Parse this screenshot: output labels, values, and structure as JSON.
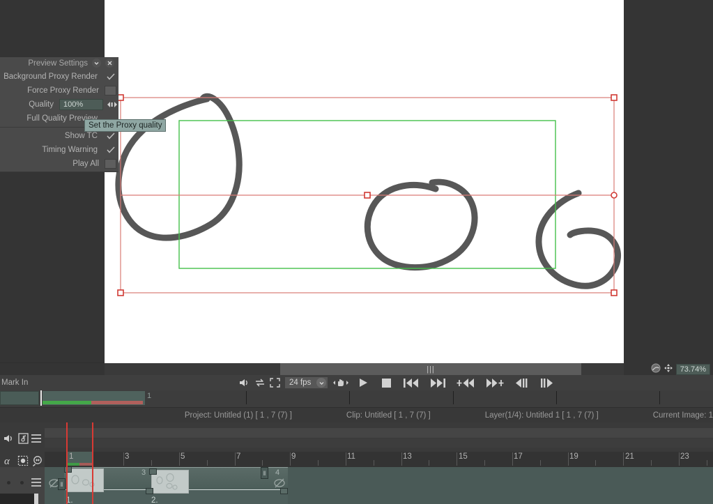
{
  "app": {
    "canvas_bg": "#ffffff",
    "ui_bg": "#3a3a3a",
    "accent_teal": "#4d5c57",
    "guide_green": "#44c04a",
    "guide_red": "#d97b76",
    "playhead_red": "#d93a34"
  },
  "preview_settings": {
    "title": "Preview Settings",
    "collapse_icon": "chevron-down-icon",
    "close_icon": "close-icon",
    "rows": [
      {
        "label": "Background Proxy Render",
        "control": "check",
        "checked": true
      },
      {
        "label": "Force Proxy Render",
        "control": "toggle",
        "checked": false
      },
      {
        "label": "Quality",
        "control": "field",
        "value": "100%"
      },
      {
        "label": "Full Quality Preview",
        "control": "none"
      },
      {
        "label": "Show TC",
        "control": "check",
        "checked": true
      },
      {
        "label": "Timing Warning",
        "control": "check",
        "checked": true
      },
      {
        "label": "Play All",
        "control": "toggle",
        "checked": false
      }
    ]
  },
  "tooltip": {
    "text": "Set the Proxy quality"
  },
  "viewer": {
    "zoom_level": "73.74%",
    "fit_icon": "fit-view-icon",
    "pan_icon": "pan-move-icon",
    "scroll_grip": "|||"
  },
  "transport": {
    "mark_in_label": "Mark In",
    "sound_icon": "speaker-icon",
    "loop_icon": "loop-icon",
    "fullscreen_icon": "fullscreen-icon",
    "fps_value": "24 fps",
    "fps_dropdown_icon": "chevron-down-icon",
    "hand_icon": "hand-scrub-icon",
    "play_icon": "play-icon",
    "stop_icon": "stop-icon",
    "first_frame_icon": "skip-to-start-icon",
    "last_frame_icon": "skip-to-end-icon",
    "prev_mark_icon": "prev-mark-icon",
    "next_mark_icon": "next-mark-icon",
    "step_back_icon": "step-back-icon",
    "step_fwd_icon": "step-forward-icon"
  },
  "scrub": {
    "frame_label": "1"
  },
  "infobar": {
    "items": [
      "Project: Untitled (1) [ 1 , 7  (7) ]",
      "Clip: Untitled [ 1 , 7  (7) ]",
      "Layer(1/4): Untitled 1 [ 1 , 7  (7) ]",
      "Current Image: 1"
    ]
  },
  "timeline": {
    "tools_row1": [
      "speaker-icon",
      "image-note-icon",
      "hamburger-icon"
    ],
    "tools_row2": [
      "alpha-icon",
      "selection-icon",
      "magnifier-icon",
      "hamburger-icon"
    ],
    "ruler_numbers": [
      "1",
      "3",
      "5",
      "7",
      "9",
      "11",
      "13",
      "15",
      "17",
      "19",
      "21",
      "23"
    ],
    "layer_labels": [
      "1.",
      "2."
    ],
    "clip_markers": [
      "3",
      "4"
    ],
    "null_icon": "no-layer-icon",
    "tag_icon": "pause-tag-icon"
  }
}
